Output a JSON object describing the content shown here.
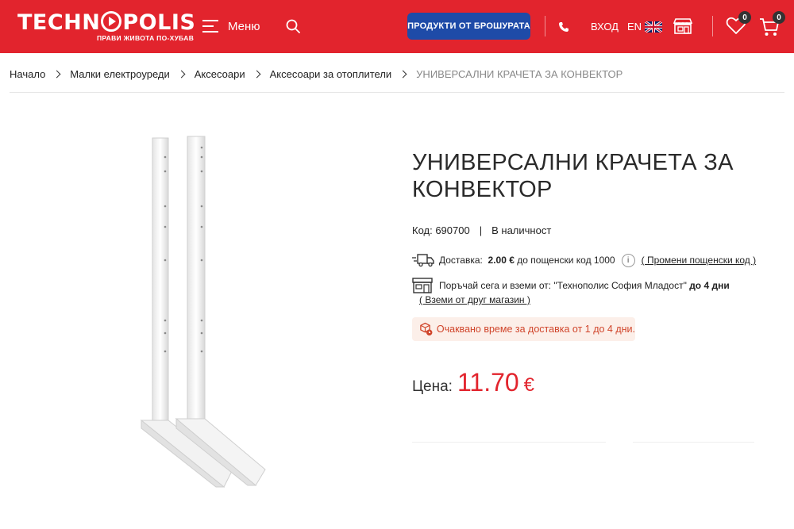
{
  "header": {
    "logo_text": "TECHNOPOLIS",
    "logo_tagline": "ПРАВИ ЖИВОТА ПО-ХУБАВ",
    "menu_label": "Меню",
    "brochure_label": "ПРОДУКТИ ОТ БРОШУРАТА",
    "login_label": "ВХОД",
    "lang_label": "EN",
    "wishlist_count": "0",
    "cart_count": "0",
    "brand_color": "#e2242d",
    "button_color": "#1e4ba8"
  },
  "breadcrumb": {
    "items": [
      "Начало",
      "Малки електроуреди",
      "Аксесоари",
      "Аксесоари за отоплители"
    ],
    "current": "УНИВЕРСАЛНИ КРАЧЕТА ЗА КОНВЕКТОР"
  },
  "product": {
    "title": "УНИВЕРСАЛНИ КРАЧЕТА ЗА КОНВЕКТОР",
    "code_label": "Код: 690700",
    "separator": "|",
    "availability": "В наличност",
    "delivery_label": "Доставка:",
    "delivery_price": "2.00 €",
    "delivery_suffix": "до пощенски код 1000",
    "info_glyph": "i",
    "change_postcode_link": "( Промени пощенски код )",
    "pickup_text": "Поръчай сега и вземи от:  \"Технополис София Младост\"",
    "pickup_days": "до 4 дни",
    "pickup_other_link": "( Вземи от друг магазин )",
    "eta_text": "Очаквано време за доставка от 1 до 4 дни.",
    "price_label": "Цена:",
    "price_value": "11.70",
    "price_currency": "€"
  }
}
